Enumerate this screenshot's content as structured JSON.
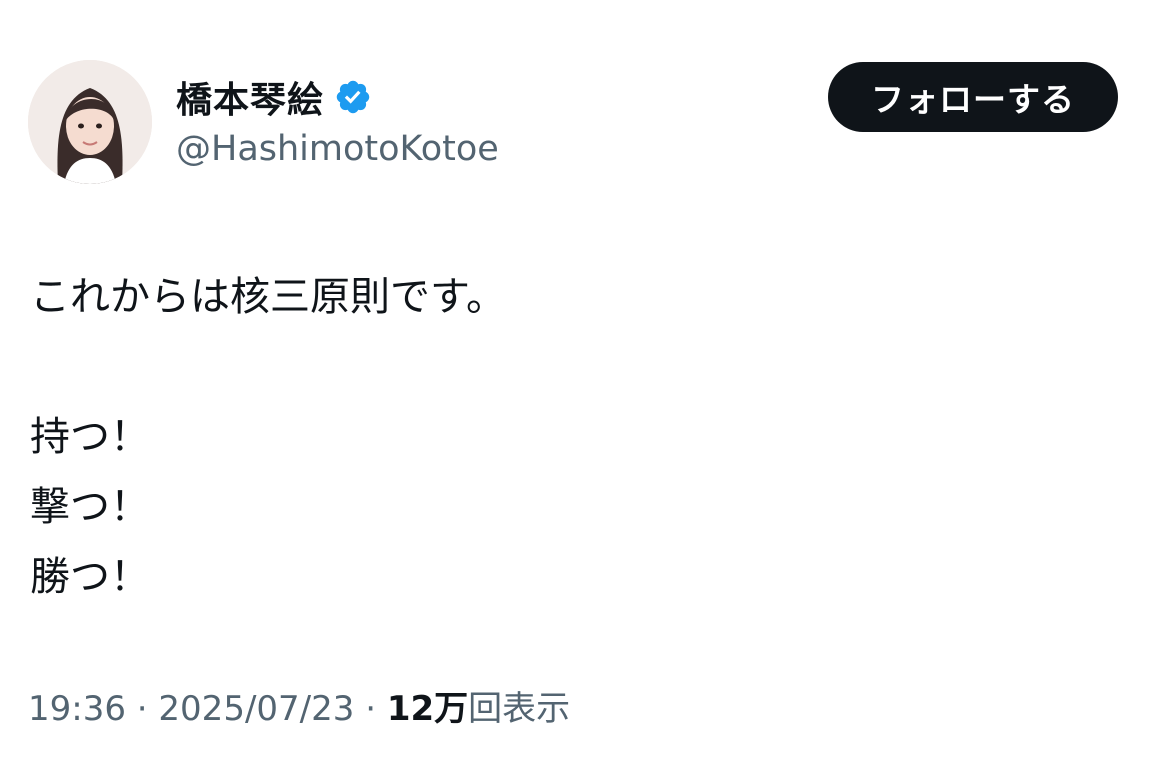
{
  "author": {
    "display_name": "橋本琴絵",
    "handle": "@HashimotoKotoe",
    "verified_icon": "verified-badge-icon",
    "verified_color": "#1d9bf0"
  },
  "follow_button": {
    "label": "フォローする"
  },
  "tweet": {
    "lines": [
      "これからは核三原則です。",
      "",
      "持つ！",
      "撃つ！",
      "勝つ！"
    ]
  },
  "meta": {
    "time": "19:36",
    "separator": " · ",
    "date": "2025/07/23",
    "views_count": "12万",
    "views_label": "回表示"
  },
  "colors": {
    "text": "#0f1419",
    "secondary": "#536471",
    "button_bg": "#0f1419",
    "background": "#ffffff"
  }
}
